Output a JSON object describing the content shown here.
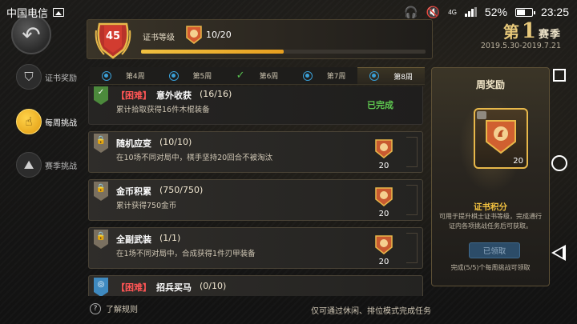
{
  "status_bar": {
    "carrier": "中国电信",
    "battery": "52%",
    "time": "23:25",
    "network": "4G"
  },
  "header": {
    "cert_level_num": "45",
    "cert_label": "证书等级",
    "cert_progress": "10/20",
    "cert_progress_fraction": 0.5,
    "season_prefix": "第",
    "season_num": "1",
    "season_suffix": "赛季",
    "season_dates": "2019.5.30-2019.7.21"
  },
  "side_nav": [
    {
      "label": "证书奖励",
      "icon": "shield-icon"
    },
    {
      "label": "每周挑战",
      "icon": "tap-icon"
    },
    {
      "label": "赛季挑战",
      "icon": "mountain-icon"
    }
  ],
  "weeks": [
    {
      "label": "第4周",
      "state": "locked"
    },
    {
      "label": "第5周",
      "state": "locked"
    },
    {
      "label": "第6周",
      "state": "done"
    },
    {
      "label": "第7周",
      "state": "locked"
    },
    {
      "label": "第8周",
      "state": "active"
    }
  ],
  "tasks": [
    {
      "hard": "【困难】",
      "title": "意外收获",
      "progress": "(16/16)",
      "desc": "累计拾取获得16件木棍装备",
      "status": "已完成",
      "reward": ""
    },
    {
      "hard": "",
      "title": "随机应变",
      "progress": "(10/10)",
      "desc": "在10场不同对局中，棋手坚持20回合不被淘汰",
      "status": "",
      "reward": "20"
    },
    {
      "hard": "",
      "title": "金币积累",
      "progress": "(750/750)",
      "desc": "累计获得750金币",
      "status": "",
      "reward": "20"
    },
    {
      "hard": "",
      "title": "全副武装",
      "progress": "(1/1)",
      "desc": "在1场不同对局中，合成获得1件刃甲装备",
      "status": "",
      "reward": "20"
    },
    {
      "hard": "【困难】",
      "title": "招兵买马",
      "progress": "(0/10)",
      "desc": "",
      "status": "",
      "reward": ""
    }
  ],
  "footer": {
    "help_text": "了解规则",
    "note": "仅可通过休闲、排位模式完成任务"
  },
  "weekly_reward": {
    "title": "周奖励",
    "card_num": "20",
    "subtitle": "证书积分",
    "desc": "可用于提升棋士证书等级，完成通行证内各项挑战任务后可获取。",
    "claim_button": "已领取",
    "footer": "完成(5/5)个每周挑战可领取"
  },
  "colors": {
    "accent_gold": "#f0c040",
    "done_green": "#5ec850",
    "hard_red": "#ff5555"
  }
}
